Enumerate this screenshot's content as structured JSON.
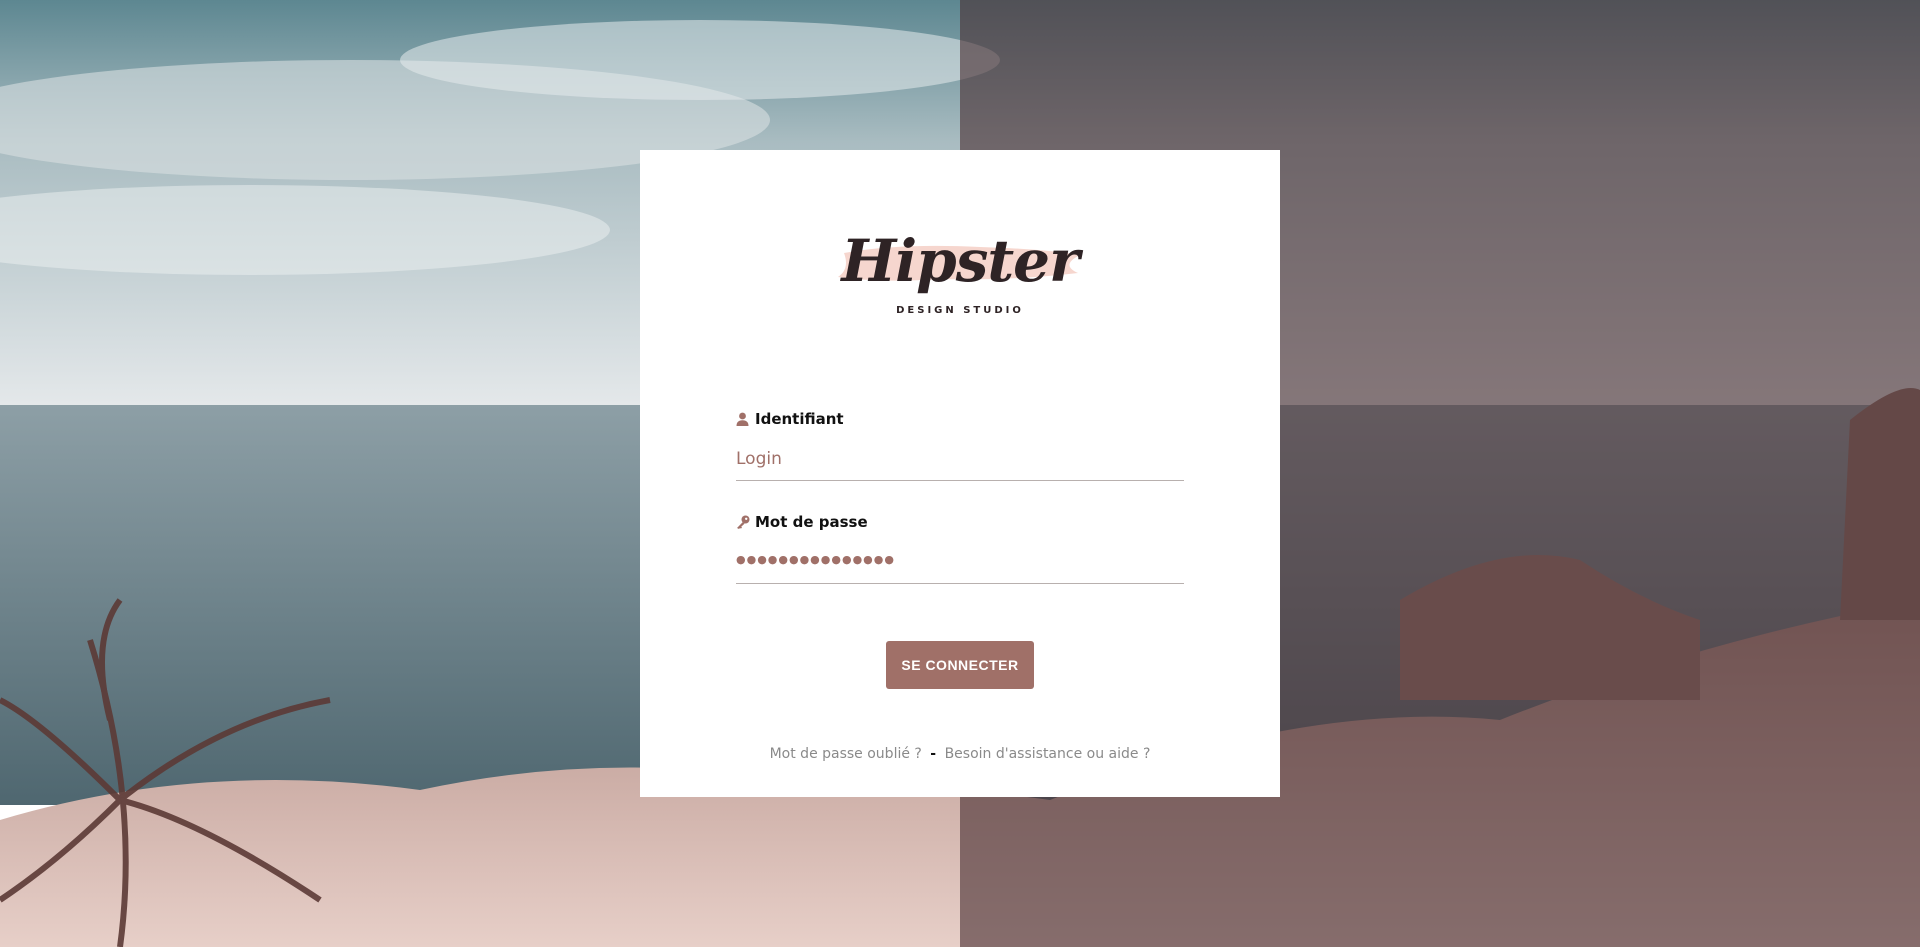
{
  "brand": {
    "name": "Hipster",
    "tagline": "DESIGN STUDIO"
  },
  "login": {
    "label": "Identifiant",
    "placeholder": "Login",
    "icon": "user-icon"
  },
  "password": {
    "label": "Mot de passe",
    "masked_value": "●●●●●●●●●●●●●●●",
    "icon": "key-icon"
  },
  "submit": {
    "label": "SE CONNECTER"
  },
  "links": {
    "forgot": "Mot de passe oublié ?",
    "separator": "-",
    "help": "Besoin d'assistance ou aide ?"
  },
  "colors": {
    "accent": "#a07068",
    "brush": "#f4cfc6",
    "text_dark": "#2e2325"
  }
}
